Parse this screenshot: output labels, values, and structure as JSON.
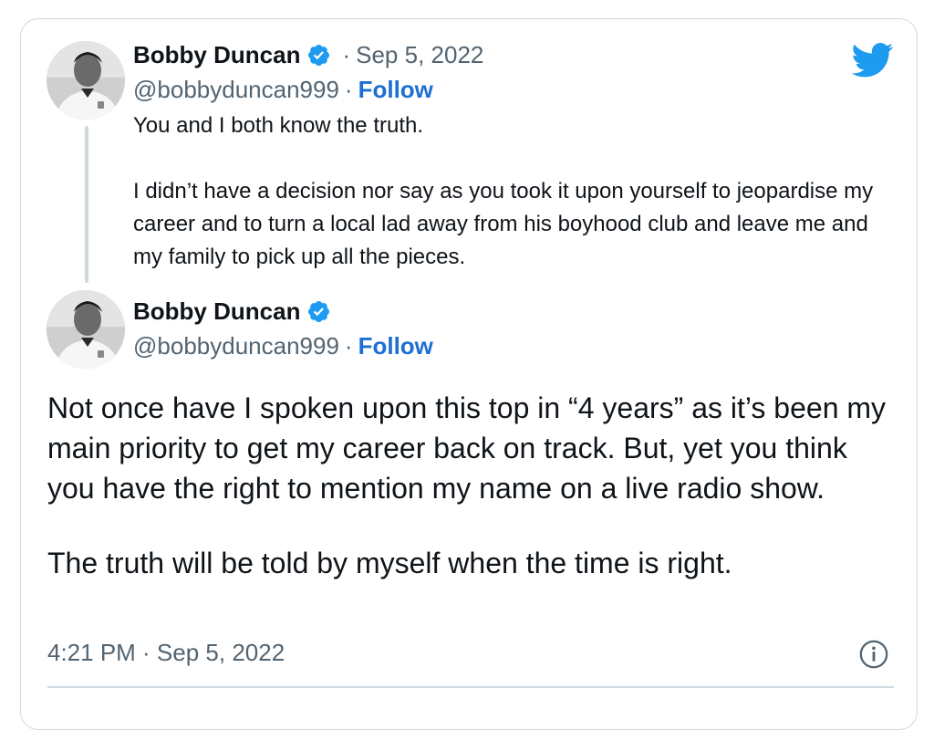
{
  "colors": {
    "text": "#0f1419",
    "secondary": "#536471",
    "link": "#1d6fd1",
    "verified": "#1d9bf0",
    "twitter_blue": "#1d9bf0",
    "border": "#cfd9de"
  },
  "reply_tweet": {
    "author_name": "Bobby Duncan",
    "separator": "·",
    "date": "Sep 5, 2022",
    "handle": "@bobbyduncan999",
    "handle_separator": "·",
    "follow_label": "Follow",
    "paragraph_1": "You and I both know the truth.",
    "paragraph_2": "I didn’t have a decision nor say as you took it upon yourself to jeopardise my career and to turn a local lad away from his boyhood club and leave me and my family to pick up all the pieces."
  },
  "main_tweet": {
    "author_name": "Bobby Duncan",
    "handle": "@bobbyduncan999",
    "handle_separator": "·",
    "follow_label": "Follow",
    "paragraph_1": "Not once have I spoken upon this top in “4 years” as it’s been my main priority to get my career back on track. But, yet you think you have the right to mention my name on a live radio show.",
    "paragraph_2": "The truth will be told by myself when the time is right.",
    "timestamp": "4:21 PM · Sep 5, 2022"
  },
  "icons": {
    "brand": "twitter-bird-icon",
    "verified": "verified-badge-icon",
    "info": "info-icon"
  }
}
